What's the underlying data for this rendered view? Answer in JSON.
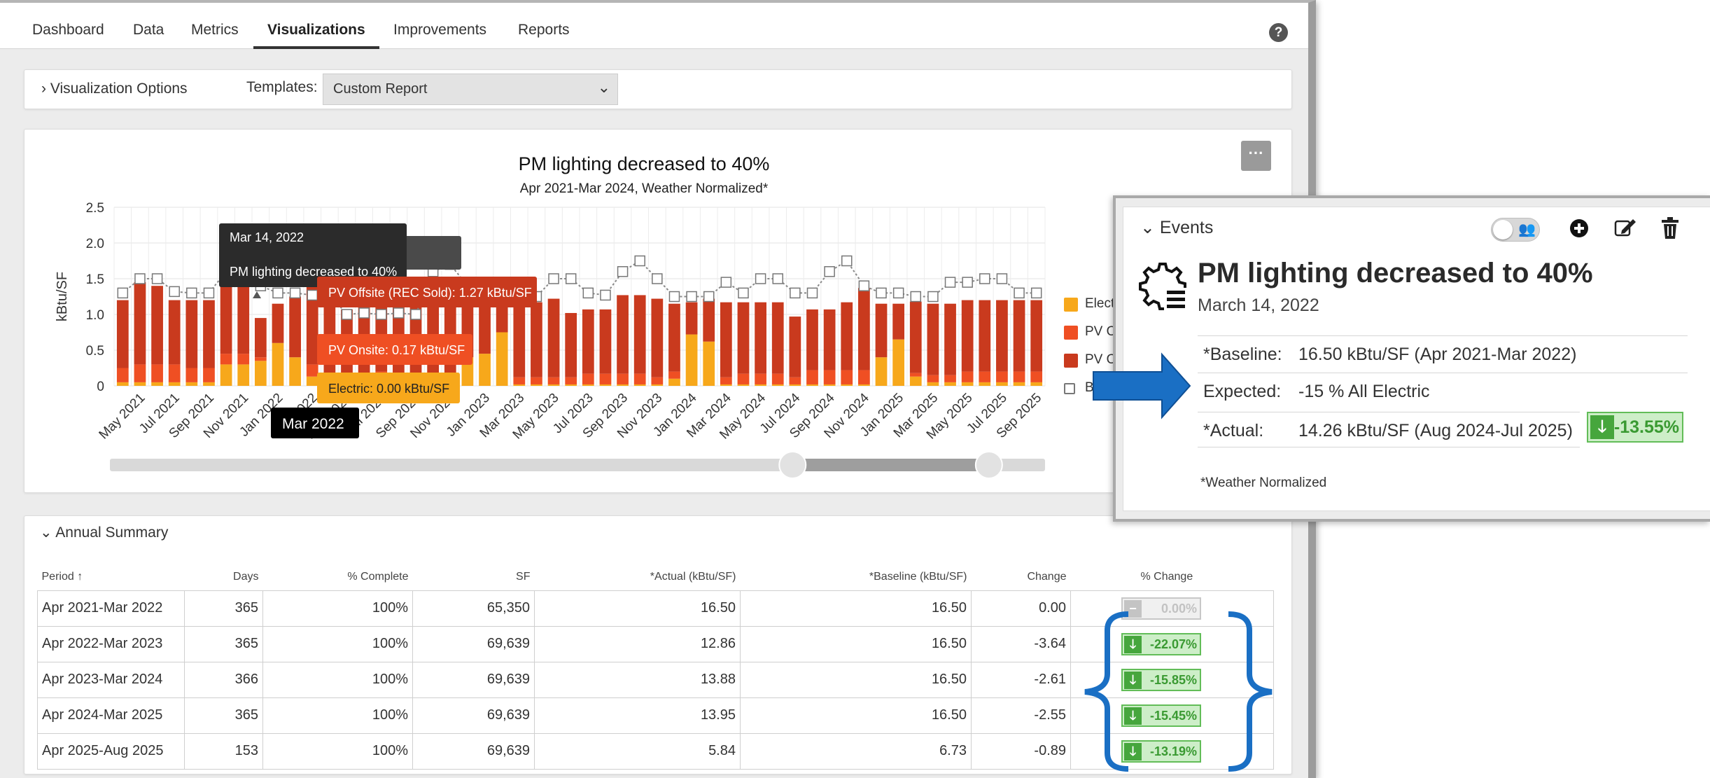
{
  "nav": {
    "tabs": [
      {
        "label": "Dashboard"
      },
      {
        "label": "Data"
      },
      {
        "label": "Metrics"
      },
      {
        "label": "Visualizations"
      },
      {
        "label": "Improvements"
      },
      {
        "label": "Reports"
      }
    ],
    "active_tab": "Visualizations",
    "help_glyph": "?"
  },
  "options": {
    "toggle_label": "› Visualization Options",
    "templates_label": "Templates:",
    "template_value": "Custom Report"
  },
  "chart_data": {
    "type": "bar",
    "title": "PM lighting decreased to 40%",
    "subtitle": "Apr 2021-Mar 2024, Weather Normalized*",
    "xlabel": "",
    "ylabel": "kBtu/SF",
    "ylim": [
      0,
      2.5
    ],
    "yticks": [
      "0",
      "0.5",
      "1.0",
      "1.5",
      "2.0",
      "2.5"
    ],
    "stacked": true,
    "x": [
      "Apr 2021",
      "May 2021",
      "Jun 2021",
      "Jul 2021",
      "Aug 2021",
      "Sep 2021",
      "Oct 2021",
      "Nov 2021",
      "Dec 2021",
      "Jan 2022",
      "Feb 2022",
      "Mar 2022",
      "Apr 2022",
      "May 2022",
      "Jun 2022",
      "Jul 2022",
      "Aug 2022",
      "Sep 2022",
      "Oct 2022",
      "Nov 2022",
      "Dec 2022",
      "Jan 2023",
      "Feb 2023",
      "Mar 2023",
      "Apr 2023",
      "May 2023",
      "Jun 2023",
      "Jul 2023",
      "Aug 2023",
      "Sep 2023",
      "Oct 2023",
      "Nov 2023",
      "Dec 2023",
      "Jan 2024",
      "Feb 2024",
      "Mar 2024",
      "Apr 2024",
      "May 2024",
      "Jun 2024",
      "Jul 2024",
      "Aug 2024",
      "Sep 2024",
      "Oct 2024",
      "Nov 2024",
      "Dec 2024",
      "Jan 2025",
      "Feb 2025",
      "Mar 2025",
      "Apr 2025",
      "May 2025",
      "Jun 2025",
      "Jul 2025",
      "Aug 2025",
      "Sep 2025"
    ],
    "xtick_labels": [
      "May 2021",
      "Jul 2021",
      "Sep 2021",
      "Nov 2021",
      "Jan 2022",
      "Mar 2022",
      "May 2022",
      "Jul 2022",
      "Sep 2022",
      "Nov 2022",
      "Jan 2023",
      "Mar 2023",
      "May 2023",
      "Jul 2023",
      "Sep 2023",
      "Nov 2023",
      "Jan 2024",
      "Mar 2024",
      "May 2024",
      "Jul 2024",
      "Sep 2024",
      "Nov 2024",
      "Jan 2025",
      "Mar 2025",
      "May 2025",
      "Jul 2025",
      "Sep 2025"
    ],
    "series": [
      {
        "name": "Electric",
        "color": "#f7a81b",
        "values": [
          0.05,
          0.05,
          0.05,
          0.05,
          0.05,
          0.05,
          0.3,
          0.3,
          0.35,
          0.6,
          0.4,
          0.13,
          0.02,
          0.02,
          0.02,
          0.05,
          0.02,
          0.02,
          0.02,
          0.05,
          0.4,
          0.45,
          0.75,
          0.02,
          0.02,
          0.02,
          0.02,
          0.02,
          0.02,
          0.02,
          0.02,
          0.02,
          0.1,
          0.72,
          0.62,
          0.02,
          0.02,
          0.02,
          0.02,
          0.02,
          0.02,
          0.02,
          0.02,
          0.02,
          0.4,
          0.65,
          0.13,
          0.05,
          0.05,
          0.05,
          0.05,
          0.05,
          0.05,
          0.05
        ]
      },
      {
        "name": "PV Onsite",
        "color": "#ef4f23",
        "values": [
          0.2,
          0.25,
          0.25,
          0.25,
          0.2,
          0.2,
          0.15,
          0.15,
          0.05,
          0.0,
          0.0,
          0.17,
          0.1,
          0.1,
          0.15,
          0.15,
          0.1,
          0.1,
          0.1,
          0.1,
          0.0,
          0.0,
          0.0,
          0.1,
          0.1,
          0.1,
          0.1,
          0.15,
          0.15,
          0.15,
          0.15,
          0.1,
          0.1,
          0.0,
          0.0,
          0.1,
          0.15,
          0.15,
          0.15,
          0.1,
          0.2,
          0.2,
          0.2,
          0.2,
          0.0,
          0.0,
          0.05,
          0.1,
          0.1,
          0.15,
          0.15,
          0.15,
          0.15,
          0.15
        ]
      },
      {
        "name": "PV Offsite (REC Sold)",
        "color": "#c93a1e",
        "values": [
          0.95,
          1.15,
          1.1,
          0.9,
          0.95,
          0.95,
          1.15,
          1.15,
          0.55,
          0.55,
          0.85,
          1.27,
          1.15,
          0.95,
          0.95,
          1.05,
          1.05,
          1.05,
          1.0,
          0.95,
          0.85,
          0.75,
          0.5,
          1.1,
          1.05,
          1.1,
          0.9,
          0.9,
          0.9,
          1.1,
          1.1,
          1.1,
          0.95,
          0.45,
          0.6,
          1.05,
          1.0,
          1.0,
          1.0,
          0.85,
          0.85,
          0.85,
          0.95,
          1.15,
          0.75,
          0.5,
          1.0,
          1.0,
          1.0,
          1.0,
          1.0,
          1.0,
          1.0,
          1.0
        ]
      },
      {
        "name": "Baseline",
        "color": "#999999",
        "values": [
          1.3,
          1.5,
          1.5,
          1.32,
          1.3,
          1.3,
          1.6,
          1.7,
          1.4,
          1.3,
          1.3,
          1.27,
          1.28,
          1.0,
          1.02,
          1.0,
          1.02,
          1.0,
          1.6,
          1.7,
          1.4,
          1.2,
          1.25,
          1.25,
          1.25,
          1.5,
          1.5,
          1.3,
          1.27,
          1.6,
          1.75,
          1.5,
          1.25,
          1.25,
          1.25,
          1.45,
          1.3,
          1.5,
          1.5,
          1.3,
          1.3,
          1.6,
          1.75,
          1.4,
          1.3,
          1.3,
          1.25,
          1.25,
          1.45,
          1.45,
          1.5,
          1.5,
          1.3,
          1.3
        ]
      }
    ],
    "legend_position": "right",
    "legend_visible": [
      "Elect",
      "PV O",
      "PV O",
      "B"
    ],
    "tooltips": [
      {
        "date": "Mar 14, 2022",
        "text": "PM lighting decreased to 40%"
      },
      {
        "label": "kBtu/SF"
      },
      {
        "text": "PV Offsite (REC Sold): 1.27 kBtu/SF"
      },
      {
        "text": "PV Onsite: 0.17 kBtu/SF"
      },
      {
        "text": "Electric: 0.00 kBtu/SF"
      },
      {
        "text": "Mar 2022"
      }
    ],
    "range_selector": {
      "start_fraction": 0.73,
      "end_fraction": 0.94
    }
  },
  "summary": {
    "title": "Annual Summary",
    "columns": [
      "Period ↑",
      "Days",
      "% Complete",
      "SF",
      "*Actual (kBtu/SF)",
      "*Baseline (kBtu/SF)",
      "Change",
      "% Change"
    ],
    "rows": [
      {
        "period": "Apr 2021-Mar 2022",
        "days": "365",
        "complete": "100%",
        "sf": "65,350",
        "actual": "16.50",
        "baseline": "16.50",
        "change": "0.00",
        "pct": "0.00%",
        "trend": "neutral"
      },
      {
        "period": "Apr 2022-Mar 2023",
        "days": "365",
        "complete": "100%",
        "sf": "69,639",
        "actual": "12.86",
        "baseline": "16.50",
        "change": "-3.64",
        "pct": "-22.07%",
        "trend": "down"
      },
      {
        "period": "Apr 2023-Mar 2024",
        "days": "366",
        "complete": "100%",
        "sf": "69,639",
        "actual": "13.88",
        "baseline": "16.50",
        "change": "-2.61",
        "pct": "-15.85%",
        "trend": "down"
      },
      {
        "period": "Apr 2024-Mar 2025",
        "days": "365",
        "complete": "100%",
        "sf": "69,639",
        "actual": "13.95",
        "baseline": "16.50",
        "change": "-2.55",
        "pct": "-15.45%",
        "trend": "down"
      },
      {
        "period": "Apr 2025-Aug 2025",
        "days": "153",
        "complete": "100%",
        "sf": "69,639",
        "actual": "5.84",
        "baseline": "6.73",
        "change": "-0.89",
        "pct": "-13.19%",
        "trend": "down"
      }
    ]
  },
  "events": {
    "header": "Events",
    "title": "PM lighting decreased to 40%",
    "date": "March 14, 2022",
    "rows": [
      {
        "key": "*Baseline:",
        "value": "16.50 kBtu/SF  (Apr 2021-Mar 2022)"
      },
      {
        "key": "Expected:",
        "value": "-15 % All Electric"
      },
      {
        "key": "*Actual:",
        "value": "14.26 kBtu/SF  (Aug 2024-Jul 2025)"
      }
    ],
    "actual_pct": "-13.55%",
    "note": "*Weather Normalized"
  },
  "colors": {
    "accent_bracket": "#1a6fc4",
    "arrow": "#1a6fc4",
    "positive_green": "#46a63d",
    "electric": "#f7a81b",
    "pv_onsite": "#ef4f23",
    "pv_offsite": "#c93a1e"
  },
  "icons": {
    "help": "question-circle-icon",
    "event_gear": "gear-list-icon",
    "add": "plus-circle-icon",
    "edit": "edit-icon",
    "delete": "trash-icon",
    "down": "arrow-down-icon"
  }
}
